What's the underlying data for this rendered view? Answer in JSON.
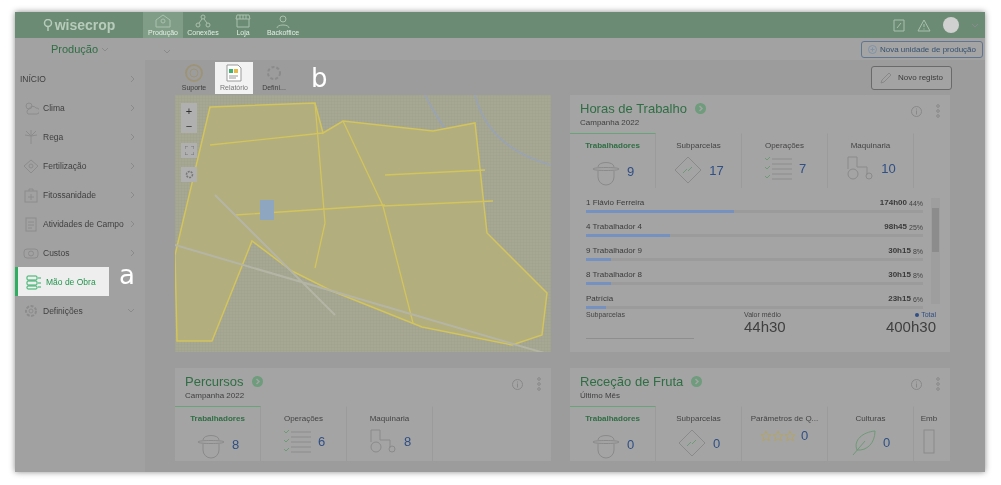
{
  "topbar": {
    "logo": "wisecrop",
    "modules": [
      {
        "label": "Produção",
        "kind": "production",
        "selected": true
      },
      {
        "label": "Conexões",
        "kind": "connections",
        "selected": false
      },
      {
        "label": "Loja",
        "kind": "shop",
        "selected": false
      },
      {
        "label": "Backoffice",
        "kind": "backoffice",
        "selected": false
      }
    ]
  },
  "subbar": {
    "unit": "Produção",
    "new_unit_button": "Nova unidade de produção"
  },
  "sidebar": {
    "items": [
      {
        "label": "INÍCIO",
        "kind": "home",
        "has_submenu": true,
        "collapsible": false,
        "selected": false,
        "highlighted": false
      },
      {
        "label": "Clima",
        "kind": "weather",
        "has_submenu": true,
        "collapsible": false,
        "selected": false,
        "highlighted": false
      },
      {
        "label": "Rega",
        "kind": "irrigation",
        "has_submenu": true,
        "collapsible": false,
        "selected": false,
        "highlighted": false
      },
      {
        "label": "Fertilização",
        "kind": "fertilization",
        "has_submenu": true,
        "collapsible": false,
        "selected": false,
        "highlighted": false
      },
      {
        "label": "Fitossanidade",
        "kind": "health",
        "has_submenu": true,
        "collapsible": false,
        "selected": false,
        "highlighted": false
      },
      {
        "label": "Atividades de Campo",
        "kind": "activities",
        "has_submenu": true,
        "collapsible": false,
        "selected": false,
        "highlighted": false
      },
      {
        "label": "Custos",
        "kind": "costs",
        "has_submenu": true,
        "collapsible": false,
        "selected": false,
        "highlighted": false
      },
      {
        "label": "Mão de Obra",
        "kind": "labour",
        "has_submenu": false,
        "collapsible": false,
        "selected": true,
        "highlighted": true
      },
      {
        "label": "Definições",
        "kind": "settings",
        "has_submenu": false,
        "collapsible": true,
        "selected": false,
        "highlighted": false
      }
    ]
  },
  "map": {
    "zoom_in": "+",
    "zoom_out": "−"
  },
  "toolbar": {
    "buttons": [
      {
        "label": "Suporte",
        "kind": "support",
        "highlighted": false
      },
      {
        "label": "Relatório",
        "kind": "report",
        "highlighted": true
      },
      {
        "label": "Defini...",
        "kind": "settings",
        "highlighted": false
      }
    ],
    "new_record_button": "Novo registo"
  },
  "annotations": [
    {
      "label": "a"
    },
    {
      "label": "b"
    }
  ],
  "work_hours": {
    "title": "Horas de Trabalho",
    "subtitle": "Campanha 2022",
    "tabs": [
      {
        "label": "Trabalhadores",
        "kind": "worker",
        "count": "9",
        "selected": true
      },
      {
        "label": "Subparcelas",
        "kind": "plot",
        "count": "17",
        "selected": false
      },
      {
        "label": "Operações",
        "kind": "operations",
        "count": "7",
        "selected": false
      },
      {
        "label": "Maquinaria",
        "kind": "tractor",
        "count": "10",
        "selected": false
      }
    ],
    "rows": [
      {
        "name": "1 Flávio Ferreira",
        "value": "174h00",
        "share": "44%",
        "level": 0.44
      },
      {
        "name": "4 Trabalhador 4",
        "value": "98h45",
        "share": "25%",
        "level": 0.25
      },
      {
        "name": "9 Trabalhador 9",
        "value": "30h15",
        "share": "8%",
        "level": 0.075
      },
      {
        "name": "8 Trabalhador 8",
        "value": "30h15",
        "share": "8%",
        "level": 0.075
      },
      {
        "name": "Patrícia",
        "value": "23h15",
        "share": "6%",
        "level": 0.06
      }
    ],
    "filter_label": "Subparcelas",
    "average_label": "Valor médio",
    "average": "44h30",
    "total_label": "Total",
    "total": "400h30"
  },
  "routes": {
    "title": "Percursos",
    "subtitle": "Campanha 2022",
    "tabs": [
      {
        "label": "Trabalhadores",
        "kind": "worker",
        "count": "8",
        "selected": true
      },
      {
        "label": "Operações",
        "kind": "operations",
        "count": "6",
        "selected": false
      },
      {
        "label": "Maquinaria",
        "kind": "tractor",
        "count": "8",
        "selected": false
      }
    ]
  },
  "fruit_reception": {
    "title": "Receção de Fruta",
    "subtitle": "Último Mês",
    "tabs": [
      {
        "label": "Trabalhadores",
        "kind": "worker",
        "count": "0",
        "selected": true
      },
      {
        "label": "Subparcelas",
        "kind": "plot",
        "count": "0",
        "selected": false
      },
      {
        "label": "Parâmetros de Q...",
        "kind": "stars",
        "count": "0",
        "selected": false
      },
      {
        "label": "Culturas",
        "kind": "leaf",
        "count": "0",
        "selected": false
      },
      {
        "label": "Emb",
        "kind": "box",
        "selected": false
      }
    ]
  }
}
